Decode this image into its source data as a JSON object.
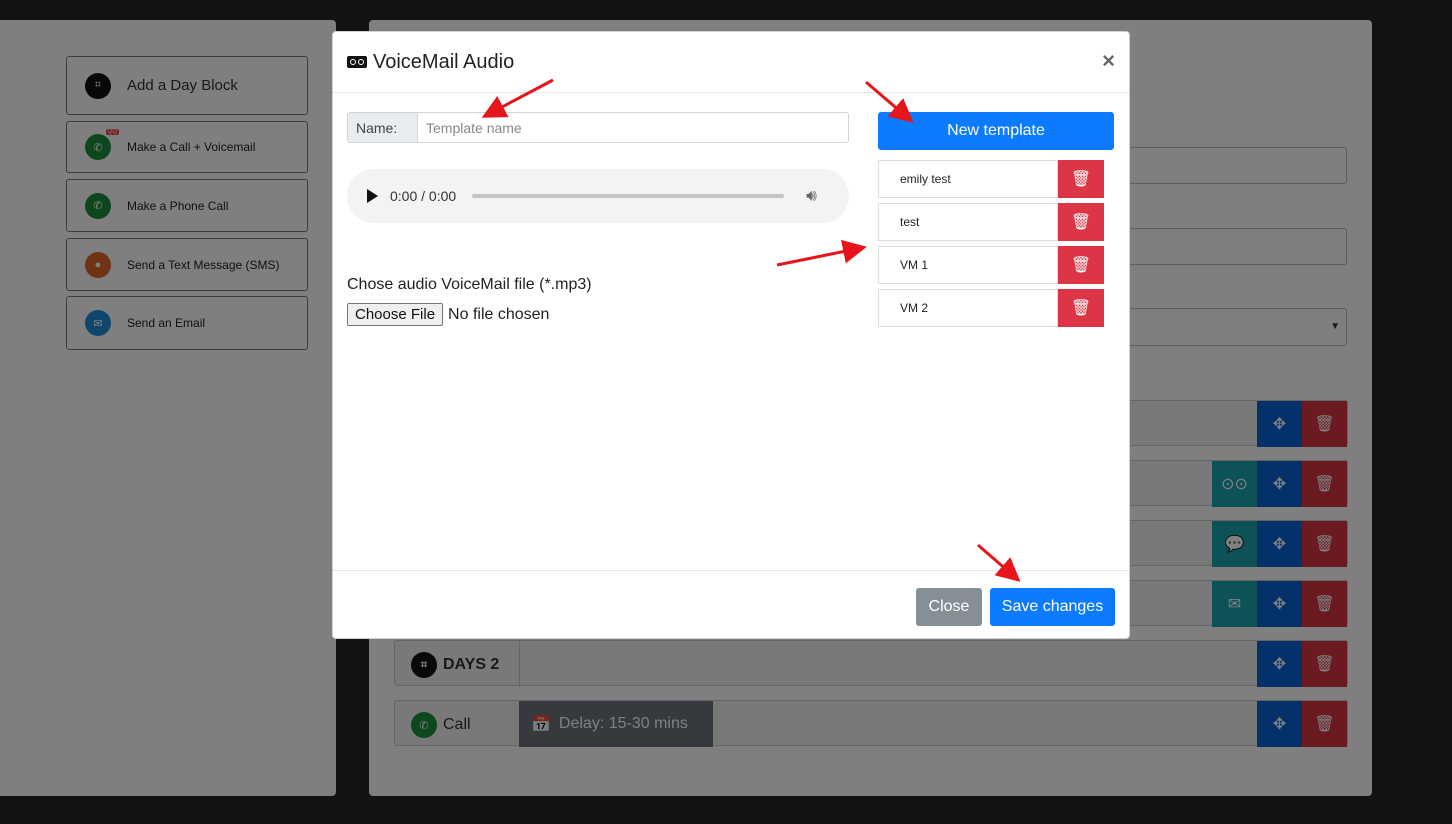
{
  "sidebar": {
    "items": [
      {
        "label": "Add a Day Block",
        "icon": "day-block-icon",
        "color": "#111111"
      },
      {
        "label": "Make a Call + Voicemail",
        "icon": "phone-voicemail-icon",
        "color": "#1a8f3c",
        "badge": "QQ"
      },
      {
        "label": "Make a Phone Call",
        "icon": "phone-icon",
        "color": "#1a8f3c"
      },
      {
        "label": "Send a Text Message (SMS)",
        "icon": "sms-icon",
        "color": "#e0672a"
      },
      {
        "label": "Send an Email",
        "icon": "email-icon",
        "color": "#1f8fd8"
      }
    ]
  },
  "sequence": {
    "day_label": "DAYS 2",
    "call_label": "Call",
    "delay_label": "Delay: 15-30 mins"
  },
  "modal": {
    "title": "VoiceMail Audio",
    "close_symbol": "×",
    "name_label": "Name:",
    "name_placeholder": "Template name",
    "name_value": "",
    "audio_time": "0:00 / 0:00",
    "file_label": "Chose audio VoiceMail file (*.mp3)",
    "file_button": "Choose File",
    "file_status": "No file chosen",
    "new_template_label": "New template",
    "templates": [
      {
        "name": "emily test"
      },
      {
        "name": "test"
      },
      {
        "name": "VM 1"
      },
      {
        "name": "VM 2"
      }
    ],
    "close_button": "Close",
    "save_button": "Save changes"
  },
  "colors": {
    "primary": "#0d7bff",
    "danger": "#dc3545",
    "secondary": "#868e96",
    "annotation_arrow": "#e8141b"
  }
}
